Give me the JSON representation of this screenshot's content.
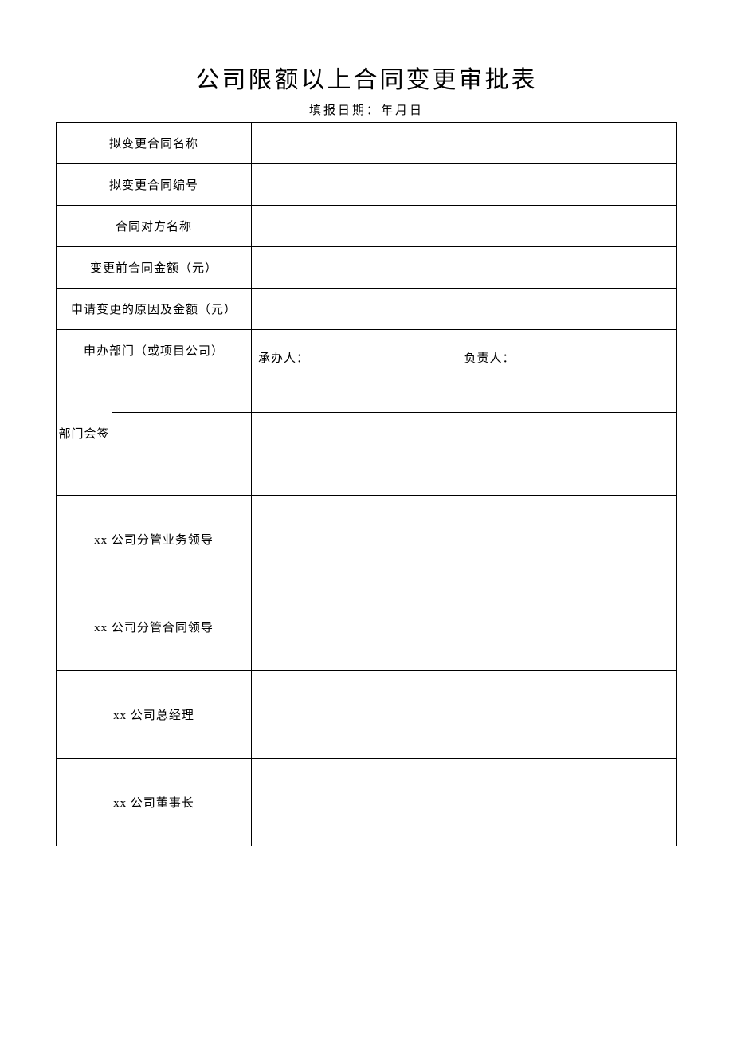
{
  "title": "公司限额以上合同变更审批表",
  "subtitle": "填报日期：年月日",
  "rows": {
    "contract_name_label": "拟变更合同名称",
    "contract_name_value": "",
    "contract_no_label": "拟变更合同编号",
    "contract_no_value": "",
    "counterparty_label": "合同对方名称",
    "counterparty_value": "",
    "amount_before_label": "变更前合同金额（元）",
    "amount_before_value": "",
    "change_reason_label": "申请变更的原因及金额（元）",
    "change_reason_value": "",
    "applicant_dept_label": "申办部门（或项目公司）",
    "handler_label": "承办人：",
    "handler_value": "",
    "responsible_label": "负责人：",
    "responsible_value": "",
    "dept_sign_label": "部门会签",
    "dept_sign_1_label": "",
    "dept_sign_1_value": "",
    "dept_sign_2_label": "",
    "dept_sign_2_value": "",
    "dept_sign_3_label": "",
    "dept_sign_3_value": "",
    "biz_leader_label": "xx 公司分管业务领导",
    "biz_leader_value": "",
    "contract_leader_label": "xx 公司分管合同领导",
    "contract_leader_value": "",
    "gm_label": "xx 公司总经理",
    "gm_value": "",
    "chairman_label": "xx 公司董事长",
    "chairman_value": ""
  }
}
